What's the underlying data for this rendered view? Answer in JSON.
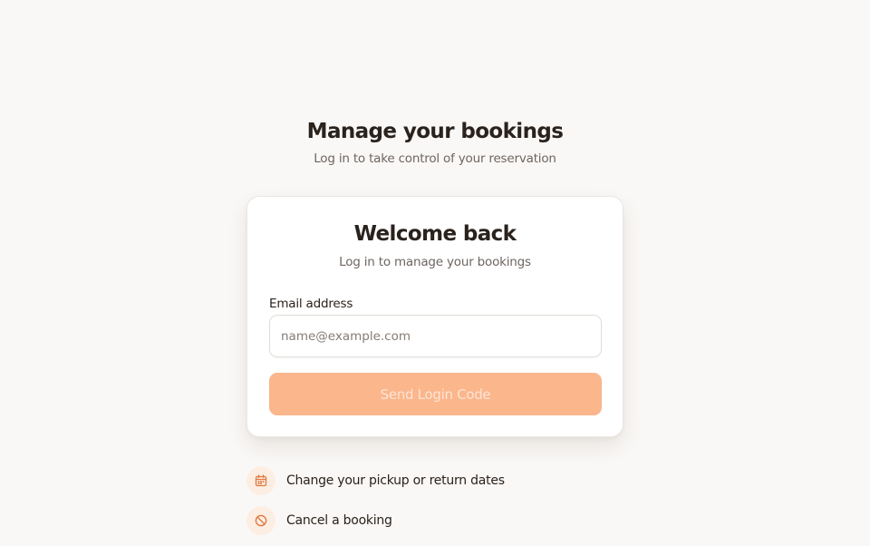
{
  "header": {
    "title": "Manage your bookings",
    "subtitle": "Log in to take control of your reservation"
  },
  "login_card": {
    "title": "Welcome back",
    "subtitle": "Log in to manage your bookings",
    "email_label": "Email address",
    "email_value": "",
    "email_placeholder": "name@example.com",
    "submit_label": "Send Login Code",
    "submit_state": "disabled"
  },
  "features": [
    {
      "icon": "calendar-icon",
      "text": "Change your pickup or return dates"
    },
    {
      "icon": "cancel-icon",
      "text": "Cancel a booking"
    }
  ],
  "colors": {
    "background": "#faf8f6",
    "accent": "#fbb68c",
    "accent_text": "#fde4d4",
    "icon_circle": "#fdeee4",
    "icon_stroke": "#e07a3f",
    "text_primary": "#2a221d",
    "text_secondary": "#6e6560"
  }
}
